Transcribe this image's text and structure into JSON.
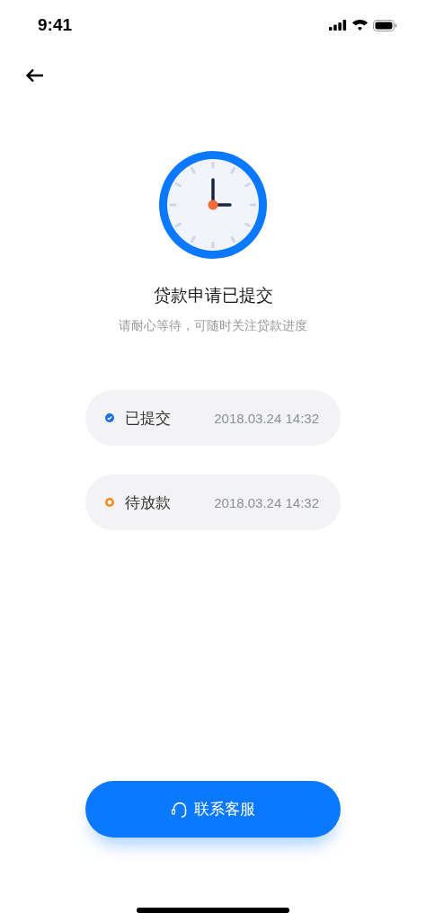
{
  "status_bar": {
    "time": "9:41"
  },
  "title": "贷款申请已提交",
  "subtitle": "请耐心等待，可随时关注贷款进度",
  "steps": [
    {
      "kind": "done",
      "label": "已提交",
      "time": "2018.03.24 14:32",
      "color": "#1f6fe5"
    },
    {
      "kind": "pending",
      "label": "待放款",
      "time": "2018.03.24 14:32",
      "color": "#f28a1e"
    }
  ],
  "contact_button": {
    "label": "联系客服"
  }
}
